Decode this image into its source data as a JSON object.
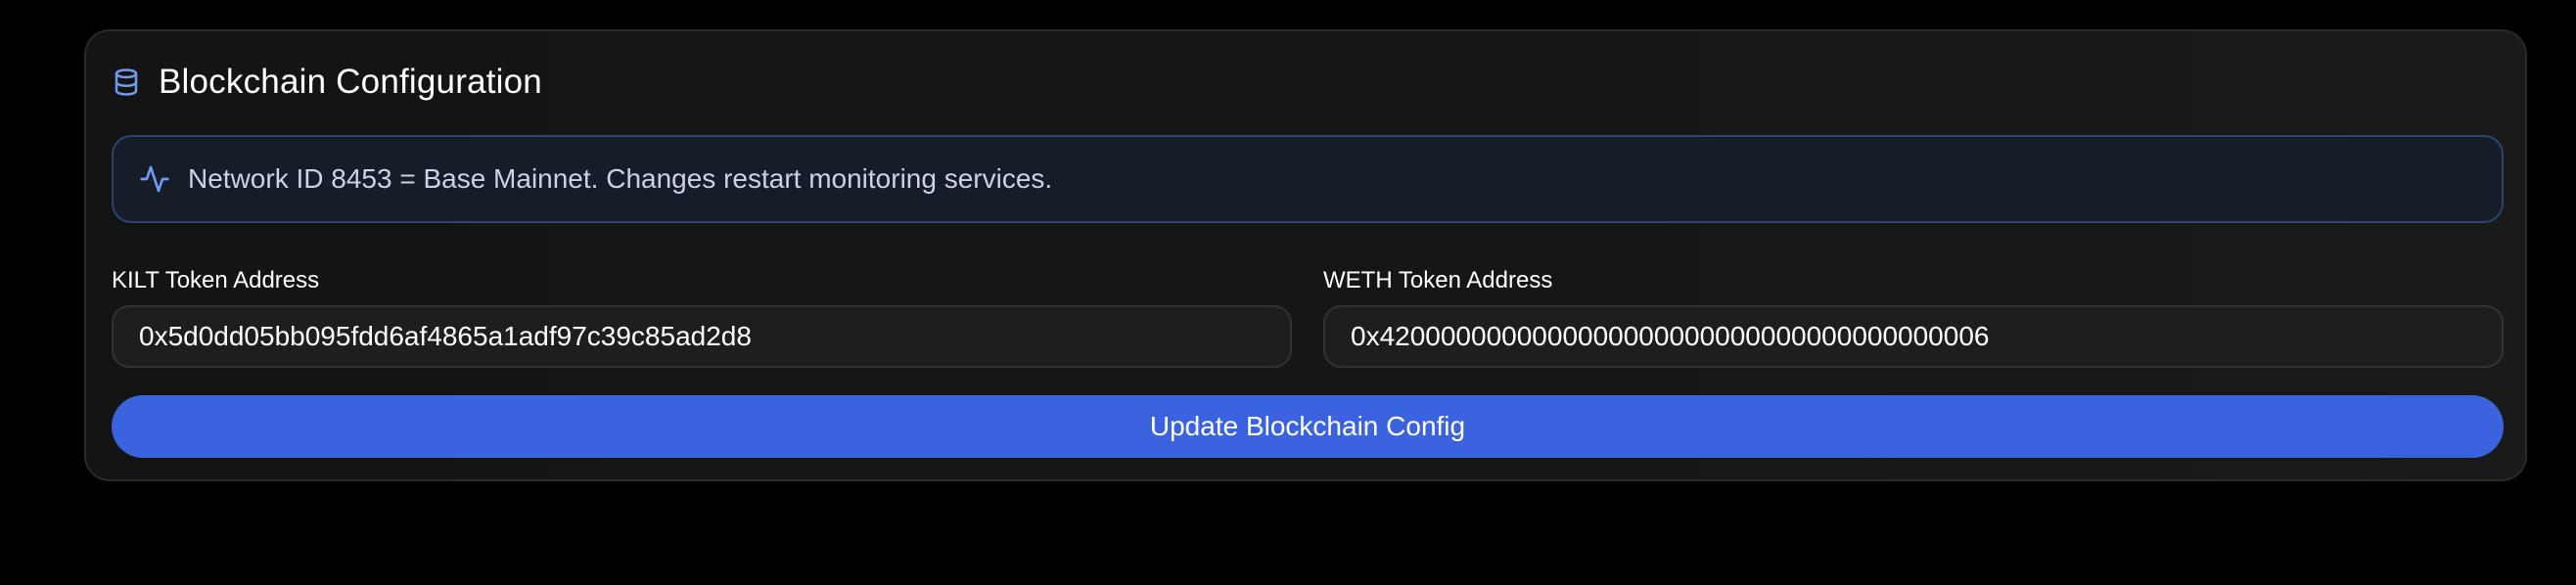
{
  "card": {
    "title": "Blockchain Configuration",
    "title_icon": "database-icon",
    "notice": {
      "icon": "activity-icon",
      "text": "Network ID 8453 = Base Mainnet. Changes restart monitoring services."
    },
    "fields": {
      "kilt": {
        "label": "KILT Token Address",
        "value": "0x5d0dd05bb095fdd6af4865a1adf97c39c85ad2d8"
      },
      "weth": {
        "label": "WETH Token Address",
        "value": "0x4200000000000000000000000000000000000006"
      }
    },
    "submit_label": "Update Blockchain Config"
  },
  "colors": {
    "background": "#000000",
    "card": "#151515",
    "accent": "#3b63e0",
    "icon": "#6f9cf0",
    "notice_border": "#2c4470"
  }
}
